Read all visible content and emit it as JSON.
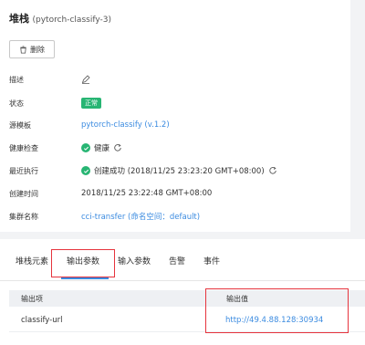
{
  "header": {
    "title": "堆栈",
    "subtitle": "(pytorch-classify-3)"
  },
  "toolbar": {
    "delete_label": "删除"
  },
  "details": {
    "description": {
      "label": "描述"
    },
    "status": {
      "label": "状态",
      "value": "正常"
    },
    "source_template": {
      "label": "源模板",
      "value": "pytorch-classify (v.1.2)"
    },
    "health_check": {
      "label": "健康检查",
      "value": "健康"
    },
    "last_execution": {
      "label": "最近执行",
      "value": "创建成功 (2018/11/25 23:23:20 GMT+08:00)"
    },
    "created_at": {
      "label": "创建时间",
      "value": "2018/11/25 23:22:48 GMT+08:00"
    },
    "cluster": {
      "label": "集群名称",
      "value": "cci-transfer (命名空间：default)"
    }
  },
  "tabs": [
    {
      "label": "堆栈元素"
    },
    {
      "label": "输出参数"
    },
    {
      "label": "输入参数"
    },
    {
      "label": "告警"
    },
    {
      "label": "事件"
    }
  ],
  "outputs_table": {
    "columns": [
      "输出项",
      "输出值"
    ],
    "rows": [
      {
        "key": "classify-url",
        "value": "http://49.4.88.128:30934"
      }
    ]
  },
  "colors": {
    "accent": "#3b8be0",
    "success": "#27b573",
    "highlight": "#e6343d"
  }
}
